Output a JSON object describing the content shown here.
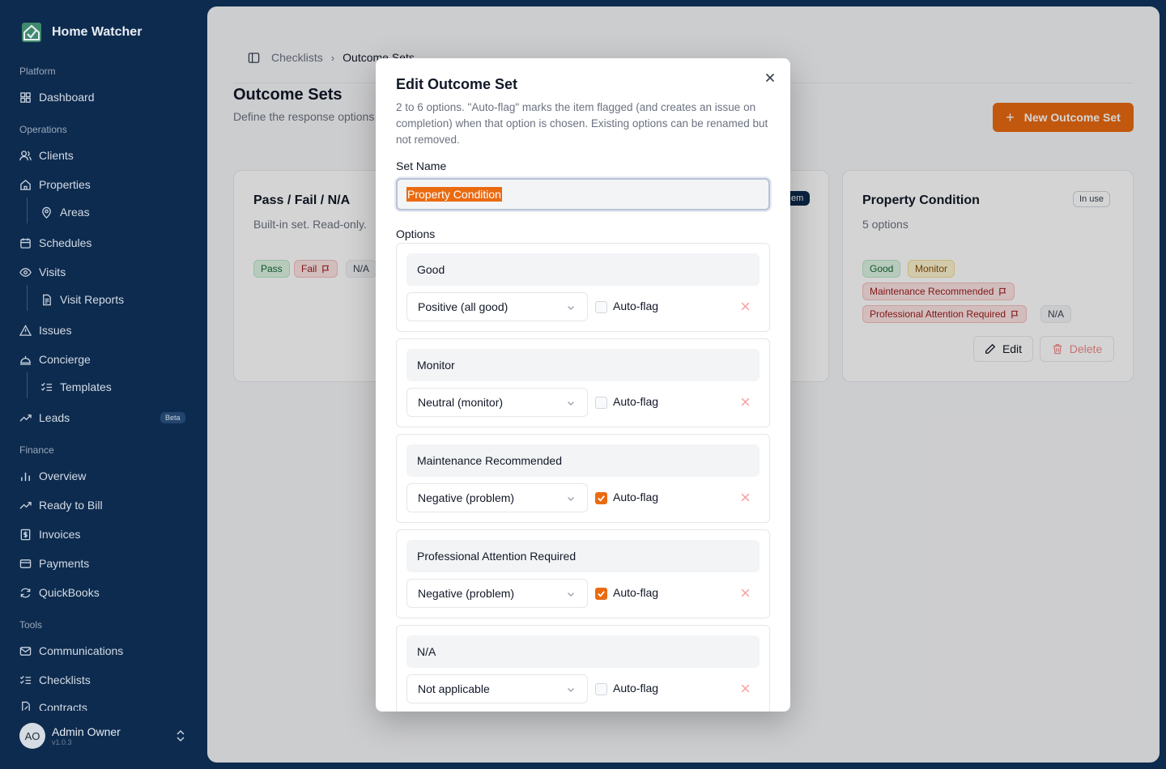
{
  "brand": {
    "name": "Home Watcher"
  },
  "sidebar": {
    "sections": {
      "platform": "Platform",
      "operations": "Operations",
      "finance": "Finance",
      "tools": "Tools"
    },
    "items": {
      "dashboard": "Dashboard",
      "clients": "Clients",
      "properties": "Properties",
      "areas": "Areas",
      "schedules": "Schedules",
      "visits": "Visits",
      "visit_reports": "Visit Reports",
      "issues": "Issues",
      "concierge": "Concierge",
      "templates": "Templates",
      "leads": "Leads",
      "leads_badge": "Beta",
      "overview": "Overview",
      "ready_to_bill": "Ready to Bill",
      "invoices": "Invoices",
      "payments": "Payments",
      "quickbooks": "QuickBooks",
      "communications": "Communications",
      "checklists": "Checklists",
      "contracts": "Contracts"
    },
    "user": {
      "initials": "AO",
      "name": "Admin Owner",
      "version": "v1.0.3"
    }
  },
  "page": {
    "breadcrumb": [
      "Checklists",
      "Outcome Sets"
    ],
    "title": "Outcome Sets",
    "subtitle": "Define the response options",
    "new_button": "New Outcome Set",
    "cards": [
      {
        "title": "Pass / Fail / N/A",
        "subtitle": "Built-in set. Read-only.",
        "chips": [
          "Pass",
          "Fail",
          "N/A"
        ]
      },
      {
        "badge": "em"
      },
      {
        "title": "Property Condition",
        "subtitle": "5 options",
        "badge": "In use",
        "chips": [
          "Good",
          "Monitor",
          "Maintenance Recommended",
          "Professional Attention Required",
          "N/A"
        ],
        "edit": "Edit",
        "delete": "Delete"
      }
    ]
  },
  "modal": {
    "title": "Edit Outcome Set",
    "description": "2 to 6 options. \"Auto-flag\" marks the item flagged (and creates an issue on completion) when that option is chosen. Existing options can be renamed but not removed.",
    "set_name_label": "Set Name",
    "set_name_value": "Property Condition",
    "options_label": "Options",
    "auto_flag_label": "Auto-flag",
    "options": [
      {
        "name": "Good",
        "type": "Positive (all good)",
        "auto_flag": false
      },
      {
        "name": "Monitor",
        "type": "Neutral (monitor)",
        "auto_flag": false
      },
      {
        "name": "Maintenance Recommended",
        "type": "Negative (problem)",
        "auto_flag": true
      },
      {
        "name": "Professional Attention Required",
        "type": "Negative (problem)",
        "auto_flag": true
      },
      {
        "name": "N/A",
        "type": "Not applicable",
        "auto_flag": false
      }
    ]
  },
  "colors": {
    "sidebar_bg": "#0d2b4e",
    "accent": "#ea6a10",
    "danger": "#ef4444"
  }
}
